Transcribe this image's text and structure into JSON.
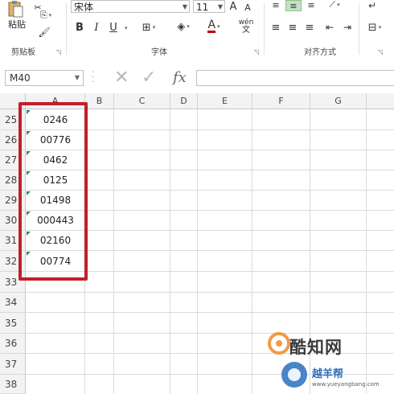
{
  "ribbon": {
    "clipboard": {
      "paste_label": "粘贴",
      "group_label": "剪贴板"
    },
    "font": {
      "font_name": "宋体",
      "font_size": "11",
      "bold": "B",
      "italic": "I",
      "underline": "U",
      "grow_font": "A",
      "shrink_font": "A",
      "font_color_letter": "A",
      "phonetic": "wén",
      "group_label": "字体"
    },
    "alignment": {
      "group_label": "对齐方式"
    }
  },
  "formula_bar": {
    "name_box": "M40",
    "fx": "fx",
    "formula": ""
  },
  "grid": {
    "columns": [
      "A",
      "B",
      "C",
      "D",
      "E",
      "F",
      "G"
    ],
    "rows": [
      {
        "num": "25",
        "a": "0246"
      },
      {
        "num": "26",
        "a": "00776"
      },
      {
        "num": "27",
        "a": "0462"
      },
      {
        "num": "28",
        "a": "0125"
      },
      {
        "num": "29",
        "a": "01498"
      },
      {
        "num": "30",
        "a": "000443"
      },
      {
        "num": "31",
        "a": "02160"
      },
      {
        "num": "32",
        "a": "00774"
      },
      {
        "num": "33",
        "a": ""
      },
      {
        "num": "34",
        "a": ""
      },
      {
        "num": "35",
        "a": ""
      },
      {
        "num": "36",
        "a": ""
      },
      {
        "num": "37",
        "a": ""
      },
      {
        "num": "38",
        "a": ""
      }
    ]
  },
  "watermark": {
    "brand": "酷知网",
    "site_cn": "越羊帮",
    "site_url": "www.yueyangbang.com"
  },
  "colors": {
    "highlight": "#c0202a",
    "number_as_text_marker": "#2e8b57",
    "font_color": "#c00000"
  }
}
